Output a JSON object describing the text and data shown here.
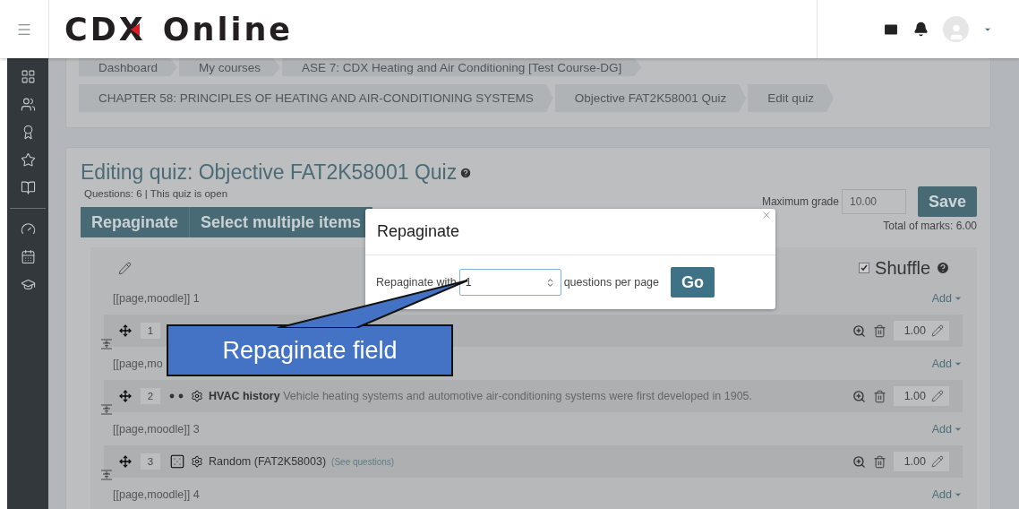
{
  "header": {
    "logo_main": "CDX",
    "logo_rest": "Online"
  },
  "breadcrumbs": [
    [
      "Dashboard",
      "My courses",
      "ASE 7: CDX Heating and Air Conditioning [Test Course-DG]"
    ],
    [
      "CHAPTER 58: PRINCIPLES OF HEATING AND AIR-CONDITIONING SYSTEMS",
      "Objective FAT2K58001 Quiz",
      "Edit quiz"
    ]
  ],
  "quiz": {
    "title": "Editing quiz: Objective FAT2K58001 Quiz",
    "info": "Questions: 6 | This quiz is open",
    "max_grade_label": "Maximum grade",
    "max_grade": "10.00",
    "save": "Save",
    "total": "Total of marks: 6.00",
    "toolbar": [
      "Repaginate",
      "Select multiple items"
    ],
    "shuffle": {
      "label": "Shuffle",
      "checked": true
    },
    "items": [
      {
        "kind": "page",
        "label": "[[page,moodle]] 1",
        "add": "Add"
      },
      {
        "kind": "question",
        "number": "1",
        "mark": "1.00"
      },
      {
        "kind": "page",
        "label": "[[page,mo",
        "add": "Add"
      },
      {
        "kind": "description",
        "number": "2",
        "name": "HVAC history",
        "text": "Vehicle heating systems and automotive air-conditioning systems were first developed in 1905.",
        "mark": "1.00"
      },
      {
        "kind": "page",
        "label": "[[page,moodle]] 3",
        "add": "Add"
      },
      {
        "kind": "random",
        "number": "3",
        "name": "Random (FAT2K58003)",
        "link": "(See questions)",
        "mark": "1.00"
      },
      {
        "kind": "page",
        "label": "[[page,moodle]] 4",
        "add": "Add"
      }
    ]
  },
  "modal": {
    "title": "Repaginate",
    "label": "Repaginate with",
    "value": "1",
    "suffix": "questions per page",
    "button": "Go"
  },
  "callout": "Repaginate field"
}
